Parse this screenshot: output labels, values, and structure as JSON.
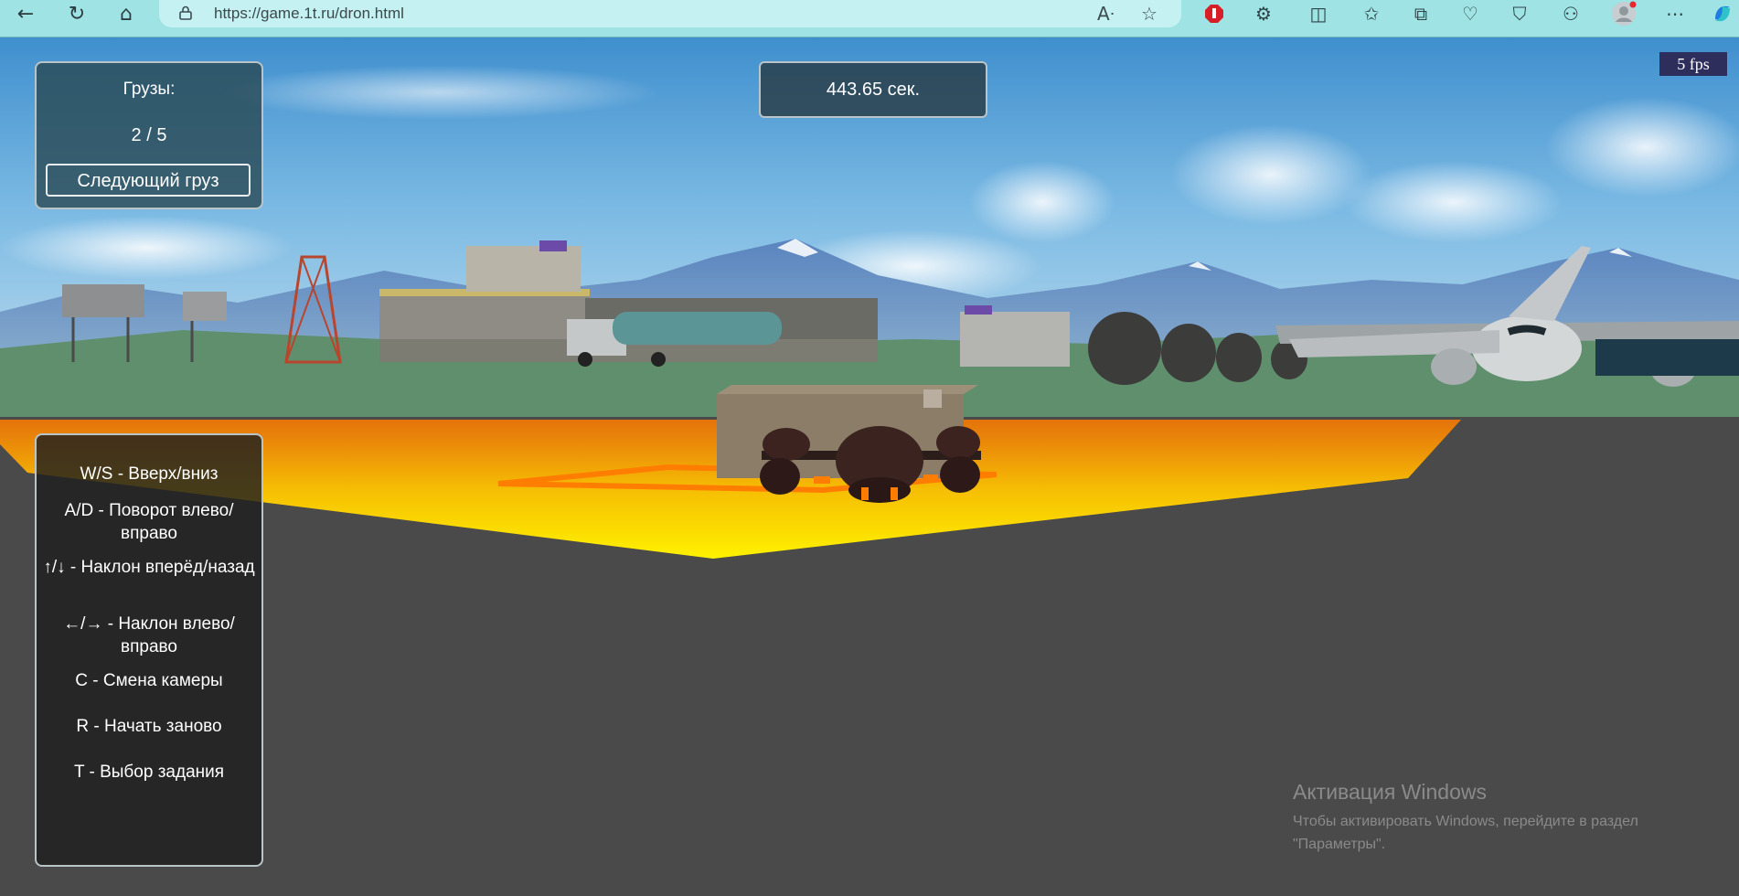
{
  "browser": {
    "url": "https://game.1t.ru/dron.html"
  },
  "game": {
    "cargo_title": "Грузы:",
    "cargo_progress": "2 / 5",
    "next_cargo_button": "Следующий груз",
    "timer": "443.65 сек.",
    "fps": "5 fps",
    "controls": [
      "W/S - Вверх/вниз",
      "A/D - Поворот влево/вправо",
      "↑/↓ - Наклон вперёд/назад",
      "←/→ - Наклон влево/вправо",
      "C - Смена камеры",
      "R - Начать заново",
      "T - Выбор задания"
    ]
  },
  "watermark": {
    "title": "Активация Windows",
    "line1": "Чтобы активировать Windows, перейдите в раздел",
    "line2": "\"Параметры\"."
  },
  "colors": {
    "chrome": "#9fe3e5",
    "ground": "#4a4a4a",
    "zone": "#ffe000"
  }
}
